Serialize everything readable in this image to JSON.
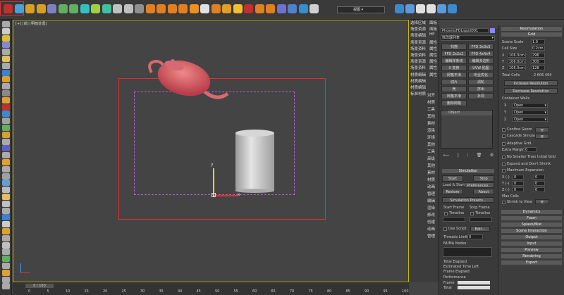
{
  "toolbar": {
    "view_dropdown": "视图",
    "colors": [
      "#c03030",
      "#4aa0d8",
      "#d8a020",
      "#d8a020",
      "#8080c0",
      "#60b060",
      "#60b060",
      "#30c0c0",
      "#a0d040",
      "#40c0a0",
      "#c0c0c0",
      "#c0c0c0",
      "#909090",
      "#e08020",
      "#e08020",
      "#e08020",
      "#e08020",
      "#f09020",
      "#e0e0e0",
      "#e08020",
      "#e0a020",
      "#f0c030",
      "#c03030",
      "#e08020",
      "#e08020",
      "#7070d0",
      "#5080d0",
      "#3090d0",
      "#d0d0d0"
    ]
  },
  "viewport": {
    "label": "[+] [前] [明暗处理]",
    "axis_y": "y",
    "axis_x": "x"
  },
  "menu": {
    "items": [
      "选择区域",
      "场景资源",
      "场景编辑",
      "场景资源",
      "场景资料",
      "场景资料",
      "场景资源",
      "场景资料",
      "材质编辑",
      "材质编辑",
      "材质编辑",
      "标准材质"
    ],
    "right_col": [
      "面板",
      "面板",
      "HP",
      "属性",
      "属性",
      "属性",
      "属性",
      "属性",
      "属性"
    ],
    "items2": [
      "对齐",
      "材质",
      "工具",
      "其他",
      "素材",
      "渲染",
      "环境",
      "其他",
      "工具",
      "高级",
      "其他",
      "素材",
      "材质",
      "动画",
      "管理",
      "编辑",
      "渲染",
      "修改",
      "创建",
      "动画",
      "管理"
    ]
  },
  "panel_mid": {
    "object_name": "PhoenixFDLiquid001",
    "modifier_list": "修改器列表",
    "buttons": [
      "扫描",
      "FFD 3x3x3",
      "FFD 2x2x2",
      "FFD 4x4x4",
      "编辑样条线",
      "编辑多边形",
      "X 变换",
      "UVW 贴图",
      "网格平滑",
      "专业优化",
      "切片",
      "涡轮",
      "壳",
      "挤出",
      "网格平滑",
      "补洞",
      "删除网格"
    ],
    "object_label": "Object",
    "sim_header": "Simulation",
    "start": "Start",
    "stop": "Stop",
    "load_start": "Load & Start",
    "preferences": "Preferences...",
    "restore": "Restore",
    "about": "About",
    "presets": "Simulation Presets...",
    "start_frame": "Start Frame",
    "stop_frame": "Stop Frame",
    "timeline": "Timeline",
    "use_script": "Use Script:",
    "edit": "Edit...",
    "threads": "Threads Limit",
    "threads_val": "0",
    "numa": "NUMA Nodes:",
    "total_elapsed": "Total Elapsed",
    "est_left": "Estimated Time Left",
    "frame_elapsed": "Frame Elapsed",
    "performance": "Performance",
    "frame": "Frame",
    "total": "Total"
  },
  "panel_right": {
    "resimulation": "Resimulation",
    "grid": "Grid",
    "scene_scale": "Scene Scale",
    "scene_scale_val": "1.0",
    "cell_size": "Cell Size",
    "cell_size_val": "0.2cm",
    "x": "X",
    "x1": "106.0cm",
    "x2": "296",
    "y": "Y",
    "y1": "106.0cm",
    "y2": "300",
    "z": "Z",
    "z1": "106.0cm",
    "z2": "128",
    "total_cells": "Total Cells",
    "total_cells_val": "2 606 464",
    "increase": "Increase Resolution",
    "decrease": "Decrease Resolution",
    "container_walls": "Container Walls",
    "open": "Open",
    "confine": "Confine Geom",
    "cascade": "Cascade Simulator",
    "none": "无",
    "adaptive": "Adaptive Grid",
    "extra_margin": "Extra Margin",
    "extra_margin_val": "0",
    "no_smaller": "No Smaller Than Initial Grid",
    "expand": "Expand and Don't Shrink",
    "max_expansion": "Maximum Expansion",
    "xm": "X (-)",
    "ym": "Y (-)",
    "zm": "Z (-)",
    "zero": "0",
    "max_cells": "Max Cells",
    "shrink": "Shrink to View",
    "sections": [
      "Dynamics",
      "Foam",
      "Splash/Mist",
      "Scene Interaction",
      "Output",
      "Input",
      "Preview",
      "Rendering",
      "Export"
    ]
  },
  "timeline": {
    "position": "0 / 100",
    "ticks": [
      "0",
      "5",
      "10",
      "15",
      "20",
      "25",
      "30",
      "35",
      "40",
      "45",
      "50",
      "55",
      "60",
      "65",
      "70",
      "75",
      "80",
      "85",
      "90",
      "95",
      "100"
    ]
  }
}
